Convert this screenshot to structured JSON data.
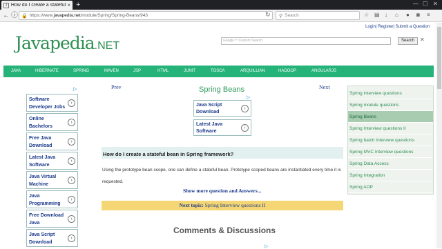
{
  "browser": {
    "tab_title": "How do I create a stateful ...",
    "url_prefix": "https://www.",
    "url_domain": "javapedia.net",
    "url_path": "/module/Spring/Spring-Beans/943",
    "search_placeholder": "Search"
  },
  "header": {
    "logo": "Javapedia",
    "logo_suffix": ".NET",
    "top_links": "Login| Register| Submit a Question",
    "cse_placeholder": "Google™ Custom Search",
    "cse_button": "Search",
    "cse_clear": "✕"
  },
  "menu": [
    "JAVA",
    "HIBERNATE",
    "SPRING",
    "MAVEN",
    "JSP",
    "HTML",
    "JUNIT",
    "TOSCA",
    "ARQUILLIAN",
    "HADOOP",
    "ANGULARJS"
  ],
  "left_ads": [
    "Software Developer Jobs",
    "Online Bachelors",
    "Free Java Download",
    "Latest Java Software",
    "Java Virtual Machine",
    "Java Programming",
    "Free Download Java",
    "Java Script Download"
  ],
  "main": {
    "prev": "Prev",
    "next": "Next",
    "page_title": "Spring Beans",
    "center_ads": [
      "Java Script Download",
      "Latest Java Software"
    ],
    "question": "How do I create a stateful bean in Spring framework?",
    "answer": "Using the prototype bean scope, one can define a stateful bean. Prototype scoped beans are instantiated every time it is requested.",
    "show_more": "Show more question and Answers...",
    "next_topic_label": "Next topic:",
    "next_topic_value": "Spring Interview questions II",
    "comments_heading": "Comments & Discussions"
  },
  "sidebar": {
    "items": [
      "Spring interview questions",
      "Spring module questions",
      "Spring Beans",
      "Spring Interview questions II",
      "Spring batch Interview questions",
      "Spring MVC Interview questions",
      "Spring Data Access",
      "Spring Integration",
      "Spring AOP"
    ],
    "active_index": 2
  }
}
